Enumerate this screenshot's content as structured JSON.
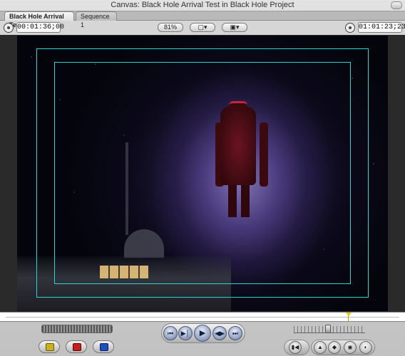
{
  "window": {
    "title": "Canvas: Black Hole Arrival Test in Black Hole Project"
  },
  "tabs": [
    {
      "label": "Black Hole Arrival Test",
      "active": true
    },
    {
      "label": "Sequence 1",
      "active": false
    }
  ],
  "controls": {
    "duration_timecode": "00:01:36;00",
    "current_timecode": "01:01:23;23",
    "zoom_label": "81%",
    "view_label": "▢▾",
    "overlay_label": "▣▾"
  },
  "transport": {
    "prev_edit": "⏮",
    "play_in_out": "▶│",
    "play": "▶",
    "play_around": "◀▶",
    "next_edit": "⏭",
    "match_frame": "▮◀",
    "mark_clip": "▲",
    "add_marker": "◆",
    "mark_in": "◉",
    "mark_out": "◐"
  },
  "colors": {
    "safe_area": "#2ad6d0",
    "mark_in_button": "#c8b020",
    "mark_out_button": "#c02020",
    "overlay_button": "#2050c0"
  }
}
